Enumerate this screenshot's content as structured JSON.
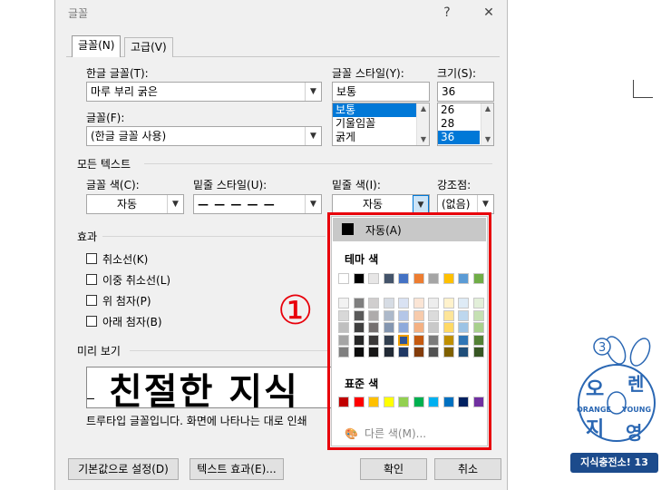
{
  "dialog": {
    "title": "글꼴",
    "help_label": "?",
    "close_label": "✕"
  },
  "tabs": [
    {
      "label": "글꼴(N)",
      "active": true
    },
    {
      "label": "고급(V)",
      "active": false
    }
  ],
  "font": {
    "korean_font_label": "한글 글꼴(T):",
    "korean_font_value": "마루 부리 굵은",
    "font_label": "글꼴(F):",
    "font_value": "(한글 글꼴 사용)",
    "style_label": "글꼴 스타일(Y):",
    "style_value": "보통",
    "style_options": [
      "보통",
      "기울임꼴",
      "굵게"
    ],
    "style_selected": 0,
    "size_label": "크기(S):",
    "size_value": "36",
    "size_options": [
      "26",
      "28",
      "36"
    ],
    "size_selected": 2
  },
  "all_text": {
    "section_title": "모든 텍스트",
    "font_color_label": "글꼴 색(C):",
    "font_color_value": "자동",
    "underline_style_label": "밑줄 스타일(U):",
    "underline_style_value": "— — — — —",
    "underline_color_label": "밑줄 색(I):",
    "underline_color_value": "자동",
    "emphasis_label": "강조점:",
    "emphasis_value": "(없음)"
  },
  "effects": {
    "section_title": "효과",
    "items": [
      {
        "label": "취소선(K)",
        "checked": false
      },
      {
        "label": "이중 취소선(L)",
        "checked": false
      },
      {
        "label": "위 첨자(P)",
        "checked": false
      },
      {
        "label": "아래 첨자(B)",
        "checked": false
      }
    ]
  },
  "preview": {
    "section_title": "미리 보기",
    "sample_text": "친절한 지식",
    "description": "트루타입 글꼴입니다. 화면에 나타나는 대로 인쇄"
  },
  "buttons": {
    "set_default": "기본값으로 설정(D)",
    "text_effects": "텍스트 효과(E)...",
    "ok": "확인",
    "cancel": "취소"
  },
  "palette": {
    "auto_label": "자동(A)",
    "theme_title": "테마 색",
    "standard_title": "표준 색",
    "more_label": "다른 색(M)...",
    "theme_top": [
      "#ffffff",
      "#000000",
      "#e7e6e6",
      "#44546a",
      "#4472c4",
      "#ed7d31",
      "#a5a5a5",
      "#ffc000",
      "#5b9bd5",
      "#70ad47"
    ],
    "theme_shades": [
      [
        "#f2f2f2",
        "#7f7f7f",
        "#d0cece",
        "#d6dce4",
        "#d9e2f3",
        "#fbe5d5",
        "#ededed",
        "#fff2cc",
        "#deebf6",
        "#e2efd9"
      ],
      [
        "#d8d8d8",
        "#595959",
        "#aeabab",
        "#adb9ca",
        "#b4c6e7",
        "#f7cbac",
        "#dbdbdb",
        "#fee599",
        "#bdd7ee",
        "#c5e0b3"
      ],
      [
        "#bfbfbf",
        "#3f3f3f",
        "#757070",
        "#8496b0",
        "#8eaadb",
        "#f4b183",
        "#c9c9c9",
        "#ffd965",
        "#9cc3e5",
        "#a8d08d"
      ],
      [
        "#a5a5a5",
        "#262626",
        "#3a3838",
        "#323f4f",
        "#2f5496",
        "#c55a11",
        "#7b7b7b",
        "#bf8f00",
        "#2e75b5",
        "#538135"
      ],
      [
        "#7f7f7f",
        "#0c0c0c",
        "#171616",
        "#222a35",
        "#1f3864",
        "#833c0b",
        "#525252",
        "#7f6000",
        "#1f4e79",
        "#375623"
      ]
    ],
    "standard": [
      "#c00000",
      "#ff0000",
      "#ffc000",
      "#ffff00",
      "#92d050",
      "#00b050",
      "#00b0f0",
      "#0070c0",
      "#002060",
      "#7030a0"
    ]
  },
  "annotation": {
    "marker": "①"
  },
  "logo": {
    "badge_number": "3",
    "name_top_left": "오",
    "name_top_right": "렌",
    "name_bottom_left": "지",
    "name_bottom_right": "영",
    "word_left": "ORANGE",
    "word_right": "YOUNG",
    "banner": "지식충전소! 13"
  }
}
